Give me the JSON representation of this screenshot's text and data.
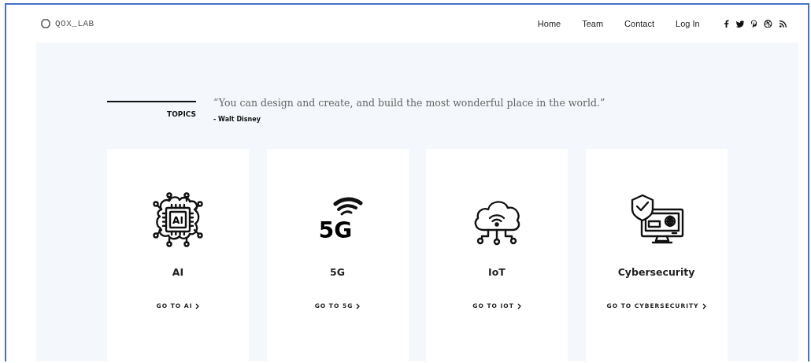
{
  "header": {
    "logo": "QOX_LAB",
    "nav": [
      {
        "label": "Home"
      },
      {
        "label": "Team"
      },
      {
        "label": "Contact"
      },
      {
        "label": "Log In"
      }
    ],
    "social": [
      {
        "kind": "facebook"
      },
      {
        "kind": "twitter"
      },
      {
        "kind": "pinterest"
      },
      {
        "kind": "dribbble"
      },
      {
        "kind": "rss"
      }
    ]
  },
  "topics": {
    "label": "TOPICS",
    "quote": "“You can design and create, and build the most wonderful place in the world.”",
    "author": "- Walt Disney"
  },
  "cards": [
    {
      "kind": "ai",
      "icon_label": "AI",
      "title": "AI",
      "link": "GO TO AI"
    },
    {
      "kind": "signal",
      "icon_label": "5G",
      "title": "5G",
      "link": "GO TO 5G"
    },
    {
      "kind": "iot",
      "title": "IoT",
      "link": "GO TO IOT"
    },
    {
      "kind": "cyber",
      "title": "Cybersecurity",
      "link": "GO TO CYBERSECURITY"
    }
  ]
}
